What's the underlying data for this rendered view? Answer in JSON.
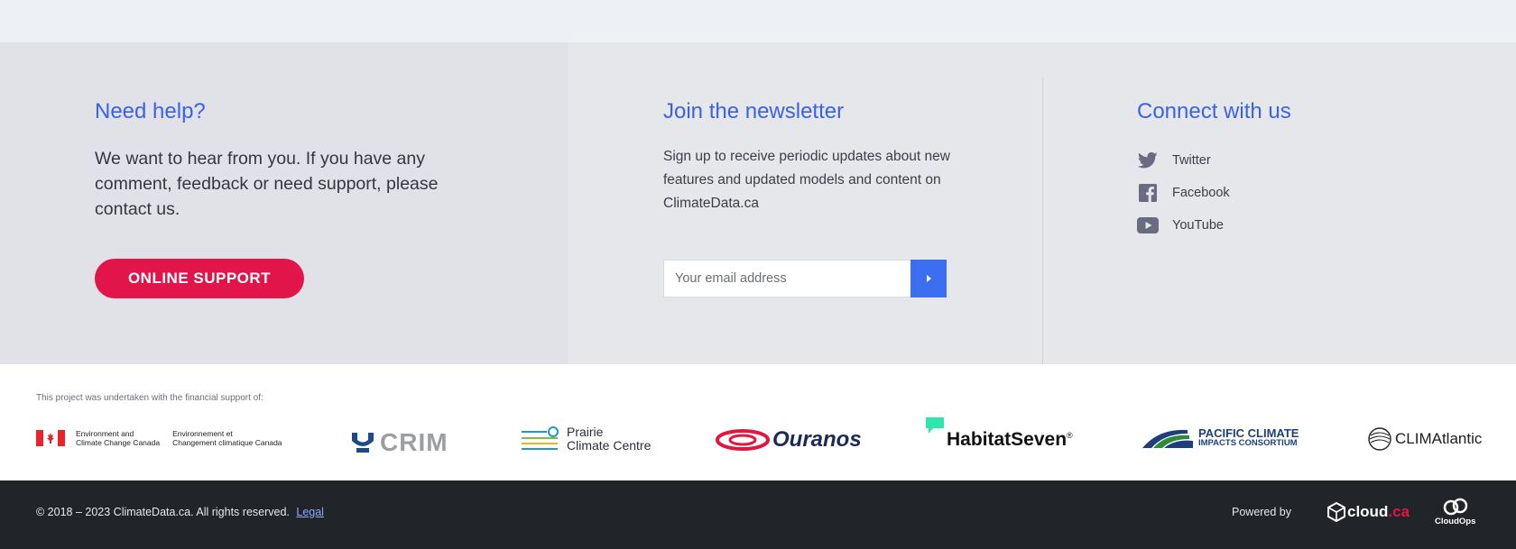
{
  "help": {
    "title": "Need help?",
    "text": "We want to hear from you. If you have any comment, feedback or need support, please contact us.",
    "button_label": "ONLINE SUPPORT"
  },
  "newsletter": {
    "title": "Join the newsletter",
    "text": "Sign up to receive periodic updates about new features and updated models and content on ClimateData.ca",
    "email_placeholder": "Your email address",
    "submit_icon": "caret-right-icon"
  },
  "connect": {
    "title": "Connect with us",
    "items": [
      {
        "label": "Twitter",
        "icon": "twitter-icon"
      },
      {
        "label": "Facebook",
        "icon": "facebook-icon"
      },
      {
        "label": "YouTube",
        "icon": "youtube-icon"
      }
    ]
  },
  "funding": {
    "note": "This project was undertaken with the financial support of:",
    "logos": {
      "eccc_en_1": "Environment and",
      "eccc_en_2": "Climate Change Canada",
      "eccc_fr_1": "Environnement et",
      "eccc_fr_2": "Changement climatique Canada",
      "crim": "CRIM",
      "prairie_1": "Prairie",
      "prairie_2": "Climate Centre",
      "ouranos": "Ouranos",
      "habitat": "HabitatSeven",
      "habitat_mark": "®",
      "pcic_1": "PACIFIC CLIMATE",
      "pcic_2": "IMPACTS CONSORTIUM",
      "climatlantic": "CLIMAtlantic"
    }
  },
  "footer": {
    "copyright": "© 2018 – 2023 ClimateData.ca. All rights reserved.",
    "legal": "Legal",
    "powered_by": "Powered by",
    "cloud": "cloud",
    "cloud_suffix": ".ca",
    "cloudops": "CloudOps"
  },
  "colors": {
    "accent": "#3a62e6",
    "button": "#e2154a",
    "submit": "#3c6ef2",
    "footer": "#212428"
  }
}
